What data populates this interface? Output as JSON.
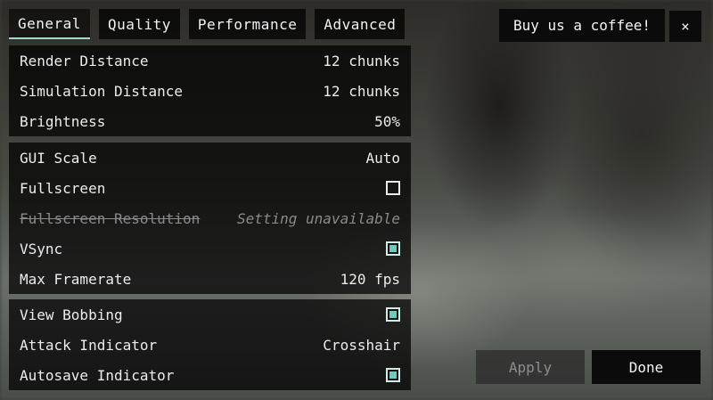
{
  "tabs": [
    {
      "label": "General",
      "active": true
    },
    {
      "label": "Quality",
      "active": false
    },
    {
      "label": "Performance",
      "active": false
    },
    {
      "label": "Advanced",
      "active": false
    }
  ],
  "header": {
    "coffee_label": "Buy us a coffee!",
    "close_label": "×"
  },
  "groups": {
    "view": [
      {
        "label": "Render Distance",
        "value": "12 chunks"
      },
      {
        "label": "Simulation Distance",
        "value": "12 chunks"
      },
      {
        "label": "Brightness",
        "value": "50%"
      }
    ],
    "display": [
      {
        "label": "GUI Scale",
        "value": "Auto"
      },
      {
        "label": "Fullscreen",
        "checked": false
      },
      {
        "label": "Fullscreen Resolution",
        "value": "Setting unavailable",
        "disabled": true
      },
      {
        "label": "VSync",
        "checked": true
      },
      {
        "label": "Max Framerate",
        "value": "120 fps"
      }
    ],
    "misc": [
      {
        "label": "View Bobbing",
        "checked": true
      },
      {
        "label": "Attack Indicator",
        "value": "Crosshair"
      },
      {
        "label": "Autosave Indicator",
        "checked": true
      }
    ]
  },
  "footer": {
    "apply_label": "Apply",
    "done_label": "Done"
  },
  "colors": {
    "accent": "#6fc9bd",
    "panel": "#000000"
  }
}
